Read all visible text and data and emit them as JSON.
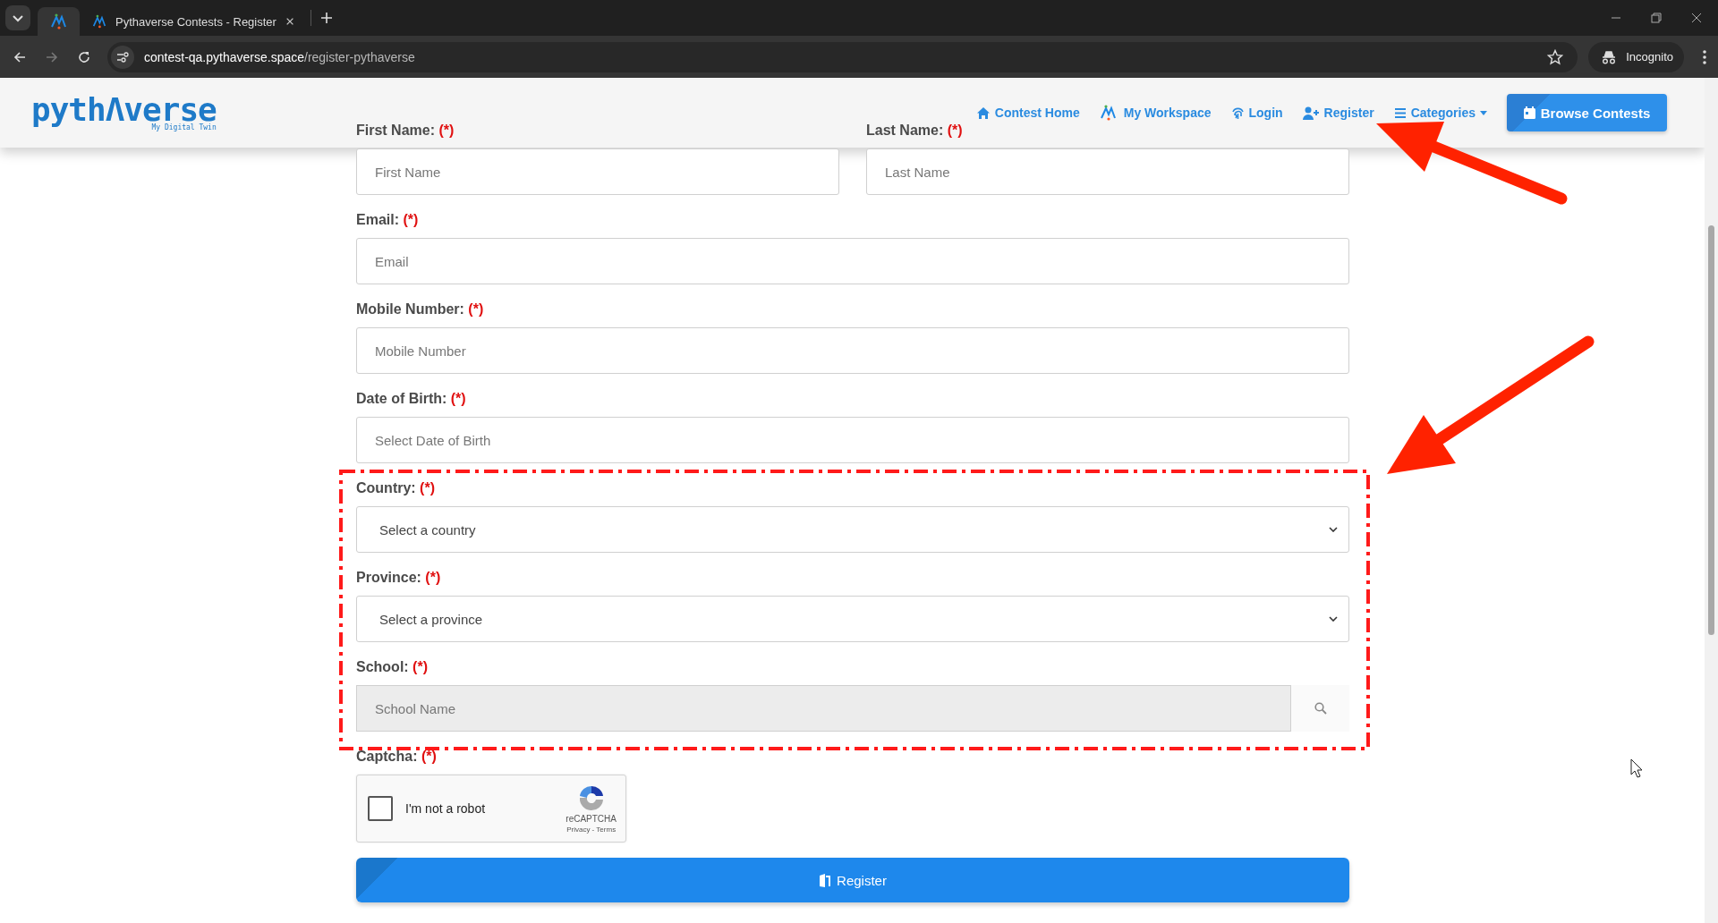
{
  "browser": {
    "tabs": [
      {
        "selected": true
      },
      {
        "title": "Pythaverse Contests - Register",
        "selected": false
      }
    ],
    "url": {
      "host": "contest-qa.pythaverse.space",
      "path": "/register-pythaverse"
    },
    "incognito": "Incognito"
  },
  "header": {
    "logo": {
      "text": "pythΛverse",
      "tagline": "My Digital Twin"
    },
    "nav": [
      {
        "kind": "home",
        "label": "Contest Home"
      },
      {
        "kind": "workspace",
        "label": "My Workspace"
      },
      {
        "kind": "login",
        "label": "Login"
      },
      {
        "kind": "register",
        "label": "Register"
      },
      {
        "kind": "categories",
        "label": "Categories"
      }
    ],
    "cta": "Browse Contests"
  },
  "form": {
    "rows": [
      [
        {
          "kind": "text",
          "label": "First Name:",
          "required": "(*)",
          "placeholder": "First Name"
        },
        {
          "kind": "text",
          "label": "Last Name:",
          "required": "(*)",
          "placeholder": "Last Name"
        }
      ],
      [
        {
          "kind": "text",
          "label": "Email:",
          "required": "(*)",
          "placeholder": "Email"
        }
      ],
      [
        {
          "kind": "text",
          "label": "Mobile Number:",
          "required": "(*)",
          "placeholder": "Mobile Number"
        }
      ],
      [
        {
          "kind": "text",
          "label": "Date of Birth:",
          "required": "(*)",
          "placeholder": "Select Date of Birth"
        }
      ],
      [
        {
          "kind": "select",
          "label": "Country:",
          "required": "(*)",
          "placeholder": "Select a country"
        }
      ],
      [
        {
          "kind": "select",
          "label": "Province:",
          "required": "(*)",
          "placeholder": "Select a province"
        }
      ],
      [
        {
          "kind": "search",
          "label": "School:",
          "required": "(*)",
          "placeholder": "School Name"
        }
      ]
    ],
    "captcha": {
      "label": "Captcha:",
      "required": "(*)",
      "checkbox": "I'm not a robot",
      "checked": false,
      "brand": "reCAPTCHA",
      "links": "Privacy - Terms"
    },
    "submit": "Register"
  }
}
